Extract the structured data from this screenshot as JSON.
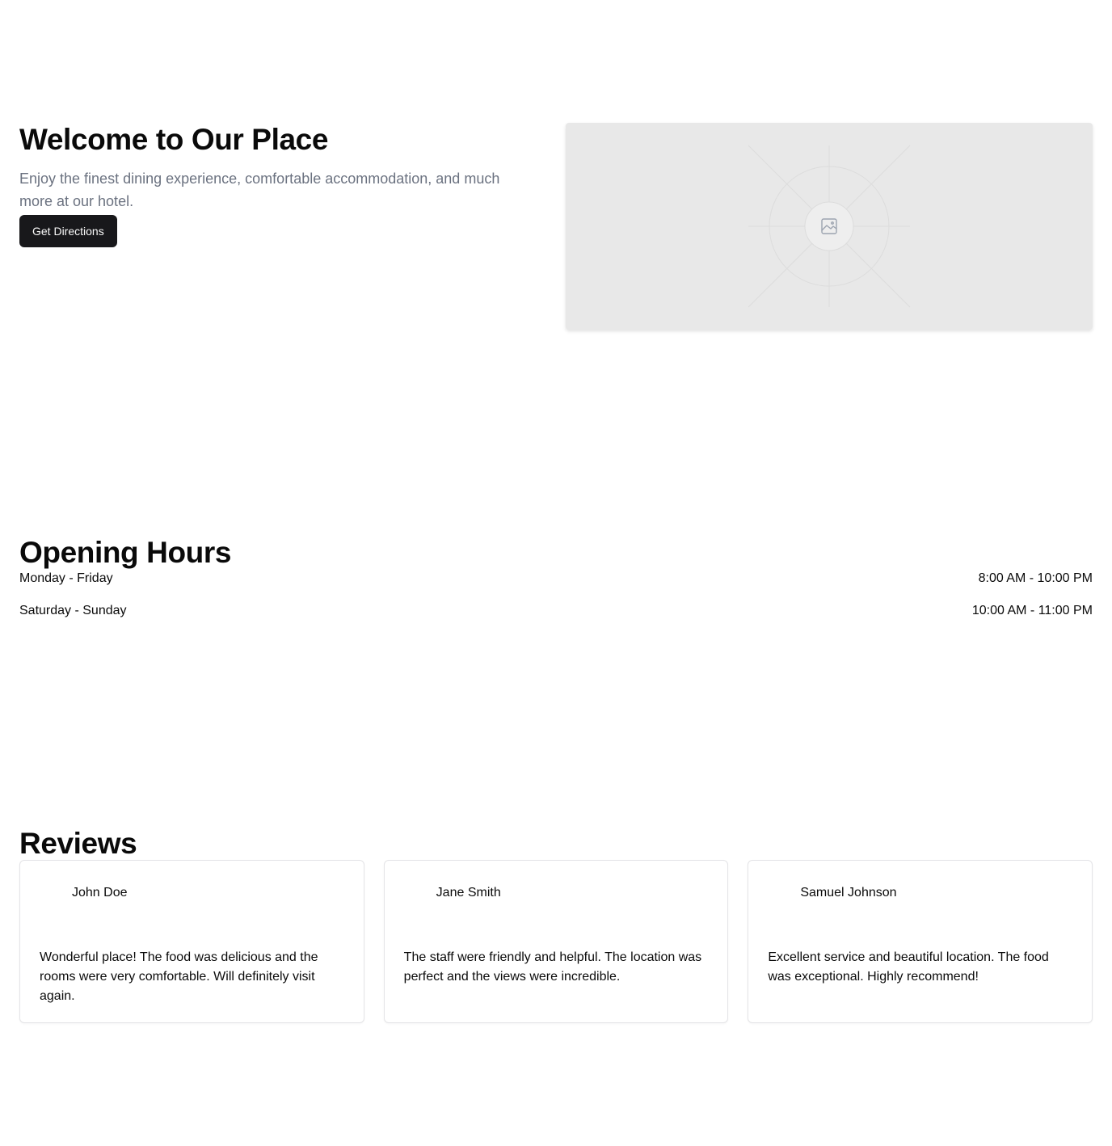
{
  "hero": {
    "title": "Welcome to Our Place",
    "subtitle": "Enjoy the finest dining experience, comfortable accommodation, and much more at our hotel.",
    "cta_label": "Get Directions",
    "image_icon": "image-placeholder-icon"
  },
  "hours": {
    "title": "Opening Hours",
    "rows": [
      {
        "days": "Monday - Friday",
        "time": "8:00 AM - 10:00 PM"
      },
      {
        "days": "Saturday - Sunday",
        "time": "10:00 AM - 11:00 PM"
      }
    ]
  },
  "reviews": {
    "title": "Reviews",
    "items": [
      {
        "name": "John Doe",
        "text": "Wonderful place! The food was delicious and the rooms were very comfortable. Will definitely visit again."
      },
      {
        "name": "Jane Smith",
        "text": "The staff were friendly and helpful. The location was perfect and the views were incredible."
      },
      {
        "name": "Samuel Johnson",
        "text": "Excellent service and beautiful location. The food was exceptional. Highly recommend!"
      }
    ]
  },
  "colors": {
    "primary_button": "#18181b",
    "muted_text": "#6b7280",
    "placeholder_bg": "#e8e8e8",
    "card_border": "#e4e4e7"
  }
}
